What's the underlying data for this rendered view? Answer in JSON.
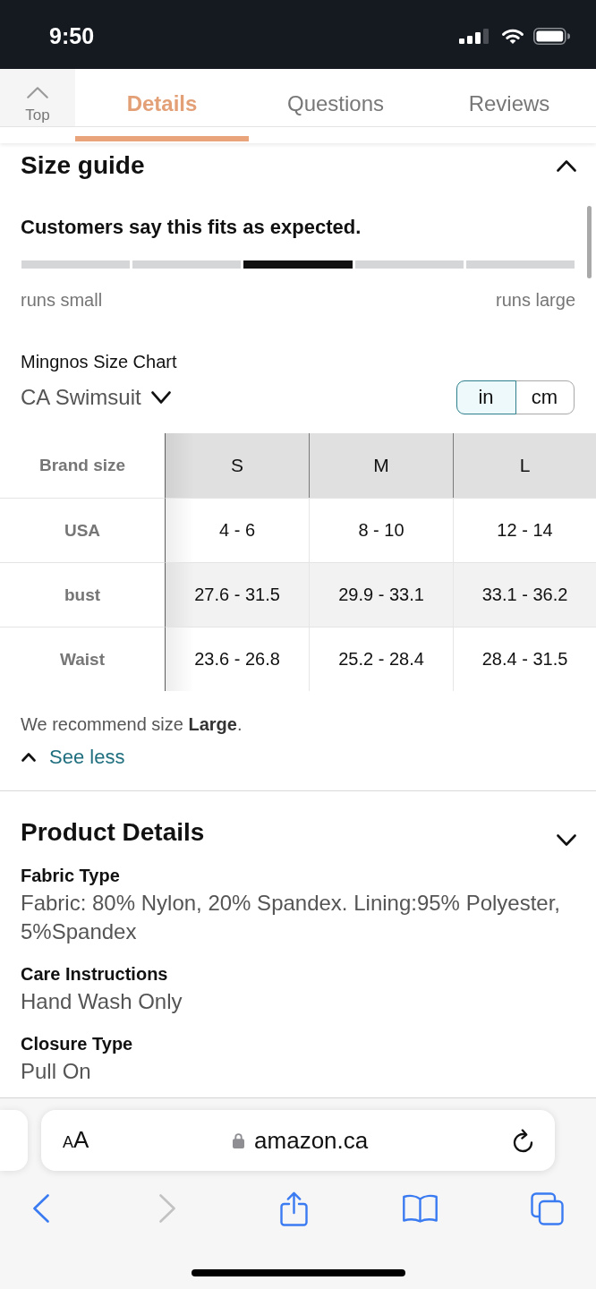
{
  "status_bar": {
    "time": "9:50"
  },
  "page_header": {
    "top_button": {
      "label": "Top"
    },
    "tabs": [
      {
        "label": "Details",
        "selected": true
      },
      {
        "label": "Questions",
        "selected": false
      },
      {
        "label": "Reviews",
        "selected": false
      }
    ]
  },
  "size_guide": {
    "title": "Size guide",
    "expanded": true,
    "fit": {
      "summary": "Customers say this fits as expected.",
      "segments": [
        {
          "selected": false
        },
        {
          "selected": false
        },
        {
          "selected": true
        },
        {
          "selected": false
        },
        {
          "selected": false
        }
      ],
      "min_label": "runs small",
      "max_label": "runs large"
    },
    "chart": {
      "title": "Mingnos Size Chart",
      "category": "CA Swimsuit",
      "units": [
        {
          "label": "in",
          "selected": true
        },
        {
          "label": "cm",
          "selected": false
        }
      ],
      "columns": [
        "Brand size",
        "S",
        "M",
        "L"
      ],
      "rows": [
        {
          "cells": [
            "USA",
            "4 - 6",
            "8 - 10",
            "12 - 14"
          ]
        },
        {
          "cells": [
            "bust",
            "27.6 - 31.5",
            "29.9 - 33.1",
            "33.1 - 36.2"
          ]
        },
        {
          "cells": [
            "Waist",
            "23.6 - 26.8",
            "25.2 - 28.4",
            "28.4 - 31.5"
          ]
        }
      ]
    },
    "recommendation": "We recommend size **Large**.",
    "toggle_link": "See less"
  },
  "product_details": {
    "title": "Product Details",
    "expanded": false,
    "attributes": [
      {
        "name": "Fabric Type",
        "value": "Fabric: 80% Nylon, 20% Spandex. Lining:95% Polyester, 5%Spandex"
      },
      {
        "name": "Care Instructions",
        "value": "Hand Wash Only"
      },
      {
        "name": "Closure Type",
        "value": "Pull On"
      }
    ]
  },
  "browser": {
    "text_size_button": "AA",
    "url": "amazon.ca",
    "toolbar": [
      {
        "kind": "back",
        "disabled": false
      },
      {
        "kind": "forward",
        "disabled": true
      },
      {
        "kind": "share",
        "disabled": false
      },
      {
        "kind": "bookmarks",
        "disabled": false
      },
      {
        "kind": "tabs",
        "disabled": false
      }
    ]
  }
}
